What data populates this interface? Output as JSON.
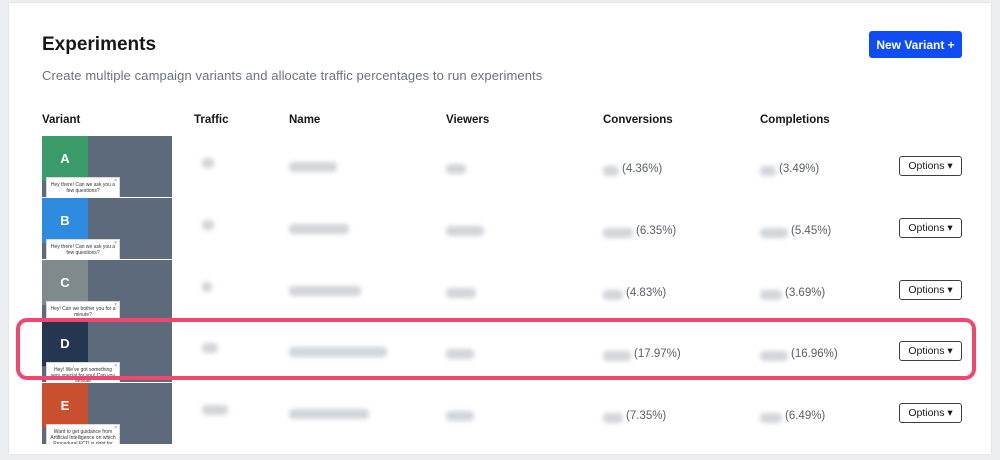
{
  "header": {
    "title": "Experiments",
    "subtitle": "Create multiple campaign variants and allocate traffic percentages to run experiments",
    "new_variant_label": "New Variant +"
  },
  "table": {
    "columns": [
      "Variant",
      "Traffic",
      "Name",
      "Viewers",
      "Conversions",
      "Completions"
    ],
    "rows": [
      {
        "letter": "A",
        "color": "#3a9b68",
        "preview": "Hey there! Can we ask you a few questions?",
        "conversion_pct": "(4.36%)",
        "completion_pct": "(3.49%)",
        "options_label": "Options ▾"
      },
      {
        "letter": "B",
        "color": "#2f8be0",
        "preview": "Hey there! Can we ask you a few questions?",
        "conversion_pct": "(6.35%)",
        "completion_pct": "(5.45%)",
        "options_label": "Options ▾"
      },
      {
        "letter": "C",
        "color": "#7e8a8c",
        "preview": "Hey! Can we bother you for a minute?",
        "conversion_pct": "(4.83%)",
        "completion_pct": "(3.69%)",
        "options_label": "Options ▾"
      },
      {
        "letter": "D",
        "color": "#243650",
        "preview": "Hey! We've got something very special for you! Can you answer",
        "conversion_pct": "(17.97%)",
        "completion_pct": "(16.96%)",
        "options_label": "Options ▾"
      },
      {
        "letter": "E",
        "color": "#c9502f",
        "preview": "Want to get guidance from Artificial Intelligence on which Procedural ECD is right for you?",
        "conversion_pct": "(7.35%)",
        "completion_pct": "(6.49%)",
        "options_label": "Options ▾"
      }
    ]
  },
  "colors": {
    "accent": "#0f4cf5",
    "highlight": "#f2466f"
  }
}
